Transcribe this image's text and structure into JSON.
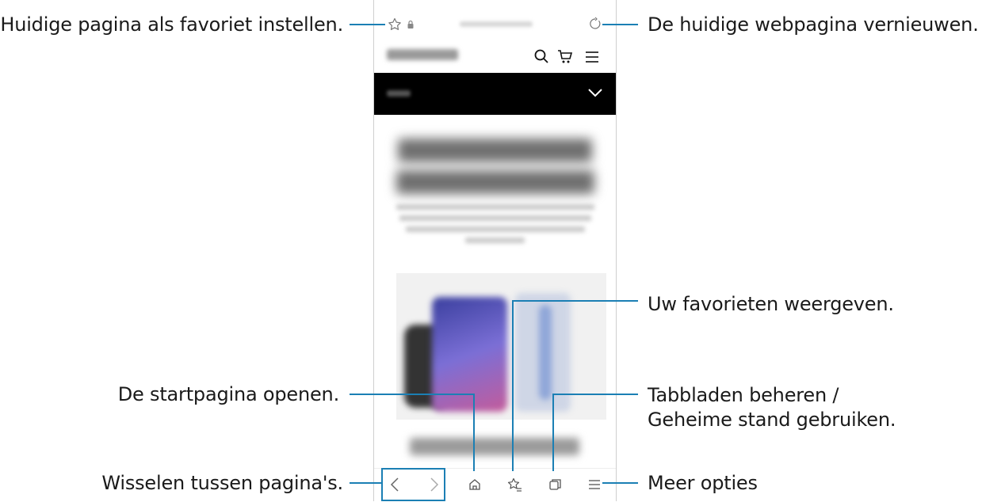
{
  "annotations": {
    "favorite": "Huidige pagina als favoriet instellen.",
    "refresh": "De huidige webpagina vernieuwen.",
    "bookmarks": "Uw favorieten weergeven.",
    "home": "De startpagina openen.",
    "tabs_line1": "Tabbladen beheren /",
    "tabs_line2": "Geheime stand gebruiken.",
    "navigate": "Wisselen tussen pagina's.",
    "more": "Meer opties"
  },
  "icons": {
    "star": "star-icon",
    "lock": "lock-icon",
    "refresh": "refresh-icon",
    "search": "search-icon",
    "cart": "cart-icon",
    "menu": "menu-icon",
    "chevron": "chevron-down-icon",
    "back": "back-icon",
    "forward": "forward-icon",
    "home": "home-icon",
    "bookmarks": "bookmarks-icon",
    "tabs": "tabs-icon",
    "more": "more-icon"
  },
  "colors": {
    "leader": "#1b7fb4",
    "header_bar": "#000000",
    "text": "#1a1a1a"
  }
}
